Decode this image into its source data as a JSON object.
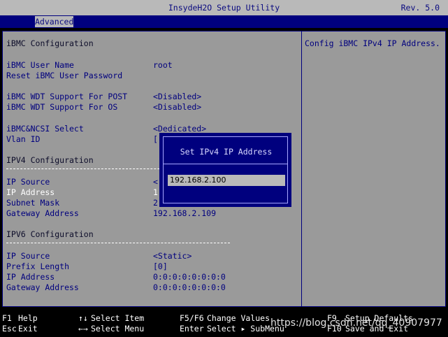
{
  "header": {
    "title": "InsydeH2O Setup Utility",
    "revision": "Rev. 5.0"
  },
  "tabs": [
    {
      "label": "Advanced"
    }
  ],
  "help_text": "Config iBMC IPv4 IP Address.",
  "section_title": "iBMC Configuration",
  "items": [
    {
      "label": "iBMC User Name",
      "value": "root"
    },
    {
      "label": "Reset iBMC User Password",
      "value": ""
    },
    {
      "label": "iBMC WDT Support For POST",
      "value": "<Disabled>"
    },
    {
      "label": "iBMC WDT Support For OS",
      "value": "<Disabled>"
    },
    {
      "label": "iBMC&NCSI Select",
      "value": "<Dedicated>"
    },
    {
      "label": "Vlan ID",
      "value": "["
    }
  ],
  "ipv4": {
    "title": "IPV4 Configuration",
    "items": [
      {
        "label": "IP Source",
        "value": "<"
      },
      {
        "label": "IP Address",
        "value": "1"
      },
      {
        "label": "Subnet Mask",
        "value": "2"
      },
      {
        "label": "Gateway Address",
        "value": "192.168.2.109"
      }
    ]
  },
  "ipv6": {
    "title": "IPV6 Configuration",
    "items": [
      {
        "label": "IP Source",
        "value": "<Static>"
      },
      {
        "label": "Prefix Length",
        "value": "[0]"
      },
      {
        "label": "IP Address",
        "value": "0:0:0:0:0:0:0:0"
      },
      {
        "label": "Gateway Address",
        "value": "0:0:0:0:0:0:0:0"
      }
    ]
  },
  "dialog": {
    "title": "Set IPv4 IP Address",
    "value": "192.168.2.100"
  },
  "keys": {
    "f1": {
      "key": "F1",
      "label": "Help"
    },
    "esc": {
      "key": "Esc",
      "label": "Exit"
    },
    "updown": {
      "key": "↑↓",
      "label": "Select Item"
    },
    "leftright": {
      "key": "←→",
      "label": "Select Menu"
    },
    "f5f6": {
      "key": "F5/F6",
      "label": "Change Values"
    },
    "enter": {
      "key": "Enter",
      "label": "Select ▸ SubMenu"
    },
    "f9": {
      "key": "F9",
      "label": "Setup Defaults"
    },
    "f10": {
      "key": "F10",
      "label": "Save and Exit"
    }
  },
  "watermark": "https://blog.csdn.net/qq_40907977"
}
